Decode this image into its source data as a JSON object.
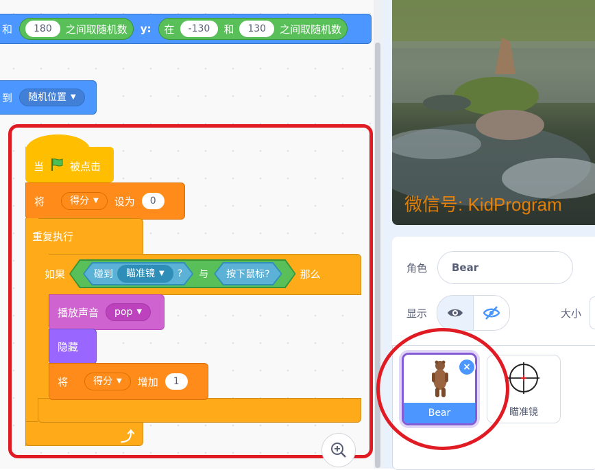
{
  "colors": {
    "motion": "#4c97ff",
    "events": "#ffbf00",
    "variables": "#ff8c1a",
    "control": "#ffab19",
    "sound": "#cf63cf",
    "looks": "#9966ff",
    "operators": "#59c059",
    "sensing": "#5cb1d6",
    "highlight": "#e01b24"
  },
  "blocks": {
    "goto_random": {
      "and1": "和",
      "min_x": "180",
      "between1": "之间取随机数",
      "y_label": "y:",
      "at": "在",
      "min_y": "-130",
      "and2": "和",
      "max_y": "130",
      "between2": "之间取随机数"
    },
    "goto_target": {
      "to": "到",
      "target": "随机位置"
    },
    "hat": {
      "when": "当",
      "flag_icon": "green-flag-icon",
      "clicked": "被点击"
    },
    "set_var": {
      "set": "将",
      "var": "得分",
      "to": "设为",
      "value": "0"
    },
    "forever": {
      "label": "重复执行"
    },
    "if": {
      "if": "如果",
      "touching": "碰到",
      "target": "瞄准镜",
      "q": "?",
      "and": "与",
      "mouse_down": "按下鼠标?",
      "then": "那么"
    },
    "play_sound": {
      "label": "播放声音",
      "sound": "pop"
    },
    "hide": {
      "label": "隐藏"
    },
    "change_var": {
      "set": "将",
      "var": "得分",
      "by": "增加",
      "value": "1"
    }
  },
  "stage": {
    "watermark": "微信号: KidProgram"
  },
  "sprite_info": {
    "sprite_label": "角色",
    "sprite_name": "Bear",
    "show_label": "显示",
    "size_label": "大小"
  },
  "sprites": [
    {
      "name": "Bear",
      "selected": true
    },
    {
      "name": "瞄准镜",
      "selected": false
    }
  ]
}
